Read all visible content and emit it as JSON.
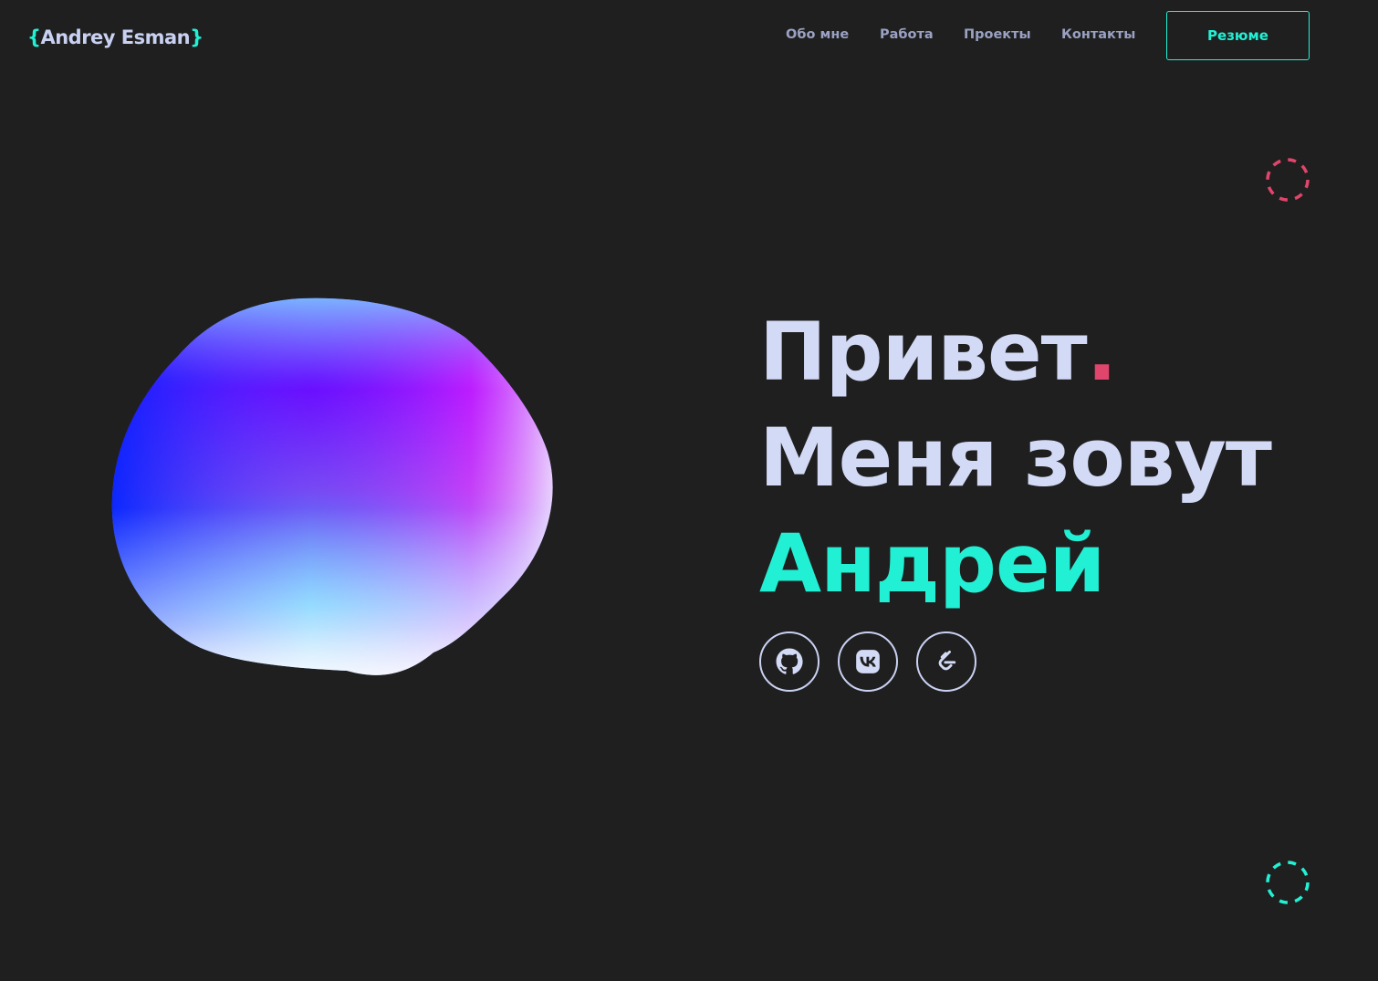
{
  "header": {
    "logo": {
      "brace_open": "{",
      "name": "Andrey Esman",
      "brace_close": "}"
    },
    "nav": {
      "about": "Обо мне",
      "work": "Работа",
      "projects": "Проекты",
      "contacts": "Контакты"
    },
    "resume_label": "Резюме"
  },
  "hero": {
    "line1": "Привет",
    "line1_dot": ".",
    "line2": "Меня зовут",
    "line3": "Андрей"
  },
  "socials": [
    {
      "icon": "github-icon"
    },
    {
      "icon": "vk-icon"
    },
    {
      "icon": "leetcode-icon"
    }
  ],
  "colors": {
    "background": "#1f1f1f",
    "accent": "#22f0d4",
    "pink": "#e0456b",
    "text": "#d3daf6",
    "nav_text": "#9aa1c2"
  }
}
